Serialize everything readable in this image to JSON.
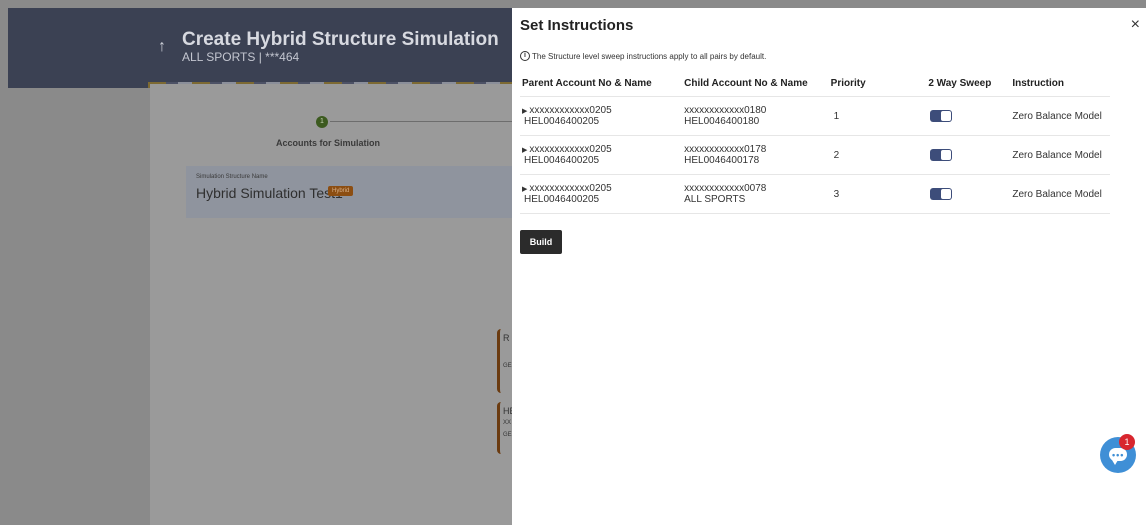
{
  "background": {
    "title": "Create Hybrid Structure Simulation",
    "subtitle": "ALL SPORTS | ***464",
    "back_icon": "↑",
    "step_number": "1",
    "step_label": "Accounts for Simulation",
    "sim_label": "Simulation Structure Name",
    "sim_name": "Hybrid Simulation Test1",
    "sim_badge": "Hybrid",
    "node1": [
      "R",
      "",
      "GE"
    ],
    "node2": [
      "HE",
      "XX",
      "GE"
    ]
  },
  "panel": {
    "title": "Set Instructions",
    "close_icon": "×",
    "info_icon": "i",
    "info_text": "The Structure level sweep instructions apply to all pairs by default.",
    "columns": {
      "parent": "Parent Account No & Name",
      "child": "Child Account No & Name",
      "priority": "Priority",
      "sweep": "2 Way Sweep",
      "instruction": "Instruction"
    },
    "rows": [
      {
        "parent_no": "xxxxxxxxxxxx0205",
        "parent_name": "HEL0046400205",
        "child_no": "xxxxxxxxxxxx0180",
        "child_name": "HEL0046400180",
        "priority": "1",
        "sweep_on": true,
        "instruction": "Zero Balance Model"
      },
      {
        "parent_no": "xxxxxxxxxxxx0205",
        "parent_name": "HEL0046400205",
        "child_no": "xxxxxxxxxxxx0178",
        "child_name": "HEL0046400178",
        "priority": "2",
        "sweep_on": true,
        "instruction": "Zero Balance Model"
      },
      {
        "parent_no": "xxxxxxxxxxxx0205",
        "parent_name": "HEL0046400205",
        "child_no": "xxxxxxxxxxxx0078",
        "child_name": "ALL SPORTS",
        "priority": "3",
        "sweep_on": true,
        "instruction": "Zero Balance Model"
      }
    ],
    "build_label": "Build"
  },
  "chat": {
    "badge_count": "1",
    "icon": "chat-icon"
  },
  "colors": {
    "toggle_on": "#3d4d7a",
    "chat": "#3f8fd6",
    "badge": "#d8262e",
    "header": "#3b4153"
  }
}
